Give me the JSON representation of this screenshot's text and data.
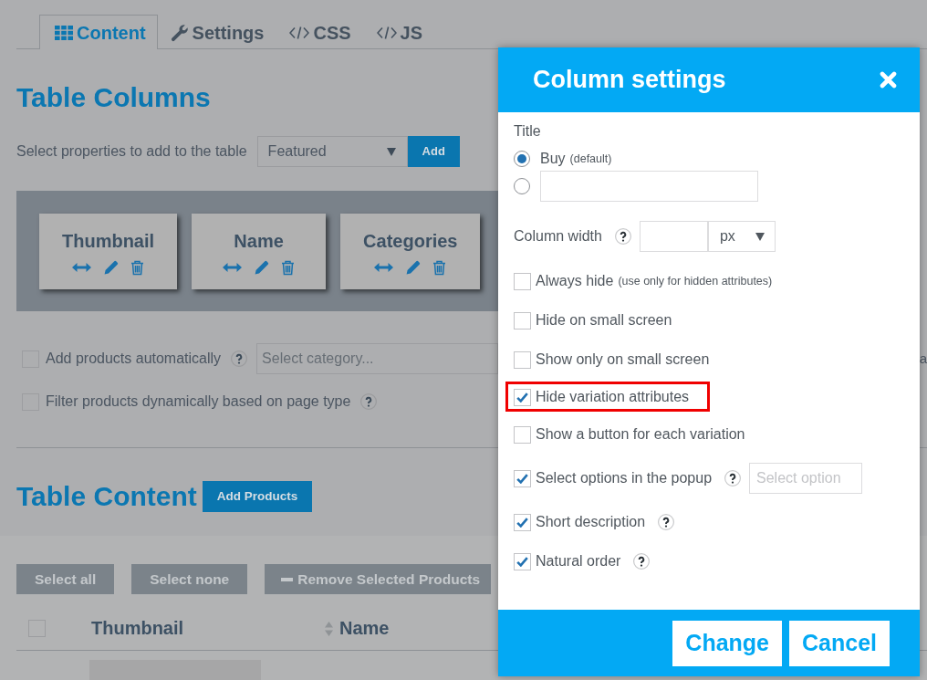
{
  "tabs": [
    {
      "label": "Content",
      "selected": true
    },
    {
      "label": "Settings",
      "selected": false
    },
    {
      "label": "CSS",
      "selected": false
    },
    {
      "label": "JS",
      "selected": false
    }
  ],
  "table_columns": {
    "heading": "Table Columns",
    "properties_label": "Select properties to add to the table",
    "properties_select": {
      "value": "Featured"
    },
    "add_button": "Add",
    "columns": [
      {
        "name": "Thumbnail"
      },
      {
        "name": "Name"
      },
      {
        "name": "Categories"
      }
    ],
    "options": [
      {
        "label": "Add products automatically",
        "checked": false,
        "help": true,
        "category_select": {
          "placeholder": "Select category..."
        },
        "edge_text": "a"
      },
      {
        "label": "Filter products dynamically based on page type",
        "checked": false,
        "help": true
      }
    ]
  },
  "table_content": {
    "heading": "Table Content",
    "add_button": "Add Products",
    "actions": [
      {
        "kind": "plain",
        "label": "Select all"
      },
      {
        "kind": "plain",
        "label": "Select none"
      },
      {
        "kind": "remove",
        "label": "Remove Selected Products"
      }
    ],
    "table": {
      "select_all_checked": false,
      "columns": [
        {
          "label": "Thumbnail",
          "sortable": false
        },
        {
          "label": "Name",
          "sortable": true
        }
      ]
    }
  },
  "modal": {
    "title": "Column settings",
    "title_field": {
      "label": "Title",
      "options": [
        {
          "kind": "preset",
          "label": "Buy",
          "note": "(default)",
          "selected": true
        },
        {
          "kind": "custom",
          "selected": false
        }
      ]
    },
    "column_width": {
      "label": "Column width",
      "help": true,
      "unit": "px"
    },
    "settings": [
      {
        "label": "Always hide",
        "note": "(use only for hidden attributes)",
        "checked": false,
        "help": false,
        "highlighted": false
      },
      {
        "label": "Hide on small screen",
        "checked": false,
        "help": false,
        "highlighted": false
      },
      {
        "label": "Show only on small screen",
        "checked": false,
        "help": false,
        "highlighted": false
      },
      {
        "label": "Hide variation attributes",
        "checked": true,
        "help": false,
        "highlighted": true
      },
      {
        "label": "Show a button for each variation",
        "checked": false,
        "help": false,
        "highlighted": false
      },
      {
        "label": "Select options in the popup",
        "checked": true,
        "help": true,
        "highlighted": false,
        "field": {
          "placeholder": "Select option"
        }
      },
      {
        "label": "Short description",
        "checked": true,
        "help": true,
        "highlighted": false
      },
      {
        "label": "Natural order",
        "checked": true,
        "help": true,
        "highlighted": false
      }
    ],
    "buttons": [
      {
        "label": "Change"
      },
      {
        "label": "Cancel"
      }
    ]
  }
}
